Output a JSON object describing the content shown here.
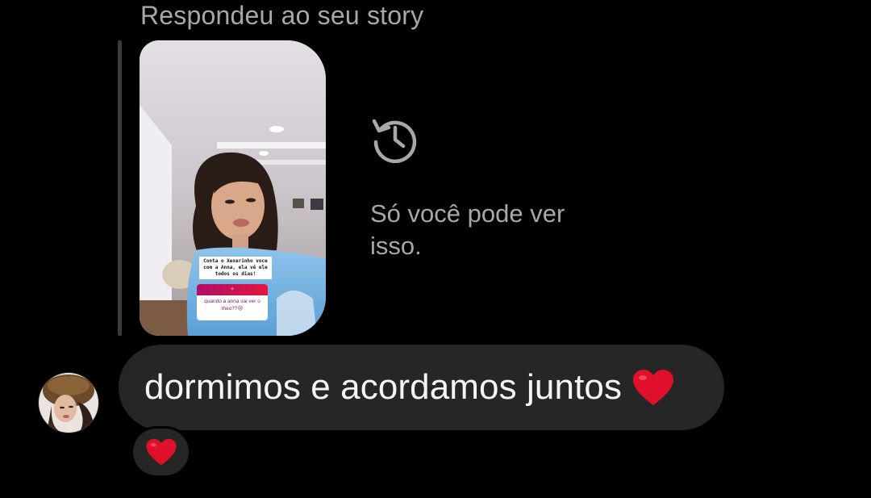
{
  "reply": {
    "header": "Respondeu ao seu story"
  },
  "story": {
    "sticker_text": "Conta o Xexerinho voce com a Anna, ela vê ele todos os dias!",
    "question_prompt": "+",
    "question_answer": "quando a anna vai ver o theo??😢"
  },
  "notice": {
    "icon": "history-icon",
    "text": "Só você pode ver isso."
  },
  "message": {
    "text": "dormimos e acordamos juntos",
    "emoji": "heart-emoji"
  },
  "reaction": {
    "emoji": "heart-emoji"
  },
  "colors": {
    "background": "#000000",
    "bubble": "#262626",
    "muted_text": "#a8a8a8",
    "heart": "#e0102a"
  }
}
